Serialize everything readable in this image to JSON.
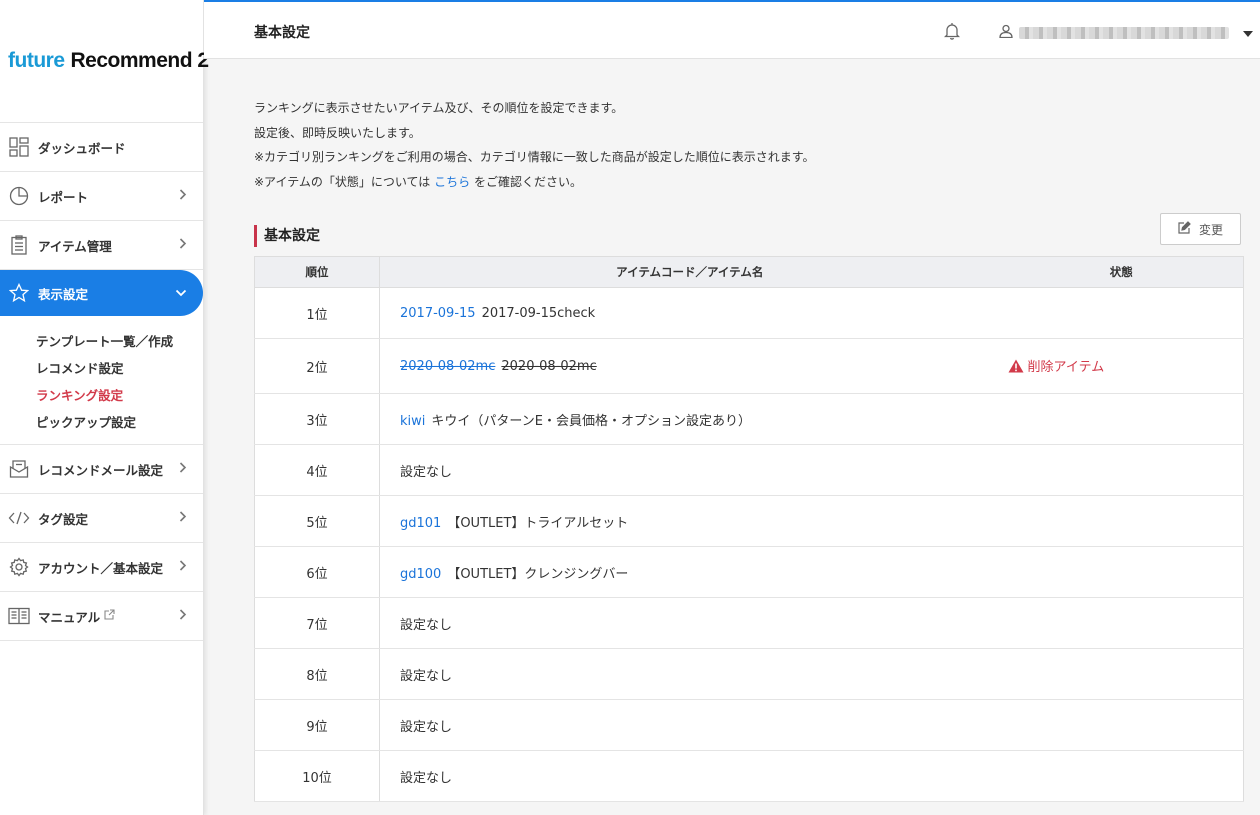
{
  "app": {
    "logo_part1": "future",
    "logo_part2": "Recommend 2"
  },
  "sidebar": {
    "items": [
      {
        "label": "ダッシュボード",
        "icon": "dashboard-icon"
      },
      {
        "label": "レポート",
        "icon": "pie-chart-icon"
      },
      {
        "label": "アイテム管理",
        "icon": "clipboard-icon"
      },
      {
        "label": "表示設定",
        "icon": "star-icon"
      },
      {
        "label": "レコメンドメール設定",
        "icon": "mail-icon"
      },
      {
        "label": "タグ設定",
        "icon": "code-icon"
      },
      {
        "label": "アカウント／基本設定",
        "icon": "gear-icon"
      },
      {
        "label": "マニュアル",
        "icon": "book-icon"
      }
    ],
    "sub_items": [
      {
        "label": "テンプレート一覧／作成"
      },
      {
        "label": "レコメンド設定"
      },
      {
        "label": "ランキング設定"
      },
      {
        "label": "ピックアップ設定"
      }
    ]
  },
  "header": {
    "title": "基本設定"
  },
  "description": {
    "line1": "ランキングに表示させたいアイテム及び、その順位を設定できます。",
    "line2": "設定後、即時反映いたします。",
    "line3": "※カテゴリ別ランキングをご利用の場合、カテゴリ情報に一致した商品が設定した順位に表示されます。",
    "line4_pre": "※アイテムの「状態」については",
    "line4_link": "こちら",
    "line4_post": "をご確認ください。"
  },
  "section": {
    "title": "基本設定",
    "edit_label": "変更"
  },
  "table": {
    "headers": [
      "順位",
      "アイテムコード／アイテム名",
      "状態"
    ],
    "rows": [
      {
        "rank": "1位",
        "code": "2017-09-15",
        "name": "2017-09-15check",
        "state": ""
      },
      {
        "rank": "2位",
        "code": "2020-08-02mc",
        "name": "2020-08-02mc",
        "state": "削除アイテム"
      },
      {
        "rank": "3位",
        "code": "kiwi",
        "name": "キウイ（パターンE・会員価格・オプション設定あり）",
        "state": ""
      },
      {
        "rank": "4位",
        "code": "",
        "name": "設定なし",
        "state": ""
      },
      {
        "rank": "5位",
        "code": "gd101",
        "name": "【OUTLET】トライアルセット",
        "state": ""
      },
      {
        "rank": "6位",
        "code": "gd100",
        "name": "【OUTLET】クレンジングバー",
        "state": ""
      },
      {
        "rank": "7位",
        "code": "",
        "name": "設定なし",
        "state": ""
      },
      {
        "rank": "8位",
        "code": "",
        "name": "設定なし",
        "state": ""
      },
      {
        "rank": "9位",
        "code": "",
        "name": "設定なし",
        "state": ""
      },
      {
        "rank": "10位",
        "code": "",
        "name": "設定なし",
        "state": ""
      }
    ]
  },
  "colors": {
    "accent": "#1a7ee5",
    "danger": "#d23a4a",
    "link": "#1a73d9",
    "logo_blue": "#1a9ad6"
  }
}
